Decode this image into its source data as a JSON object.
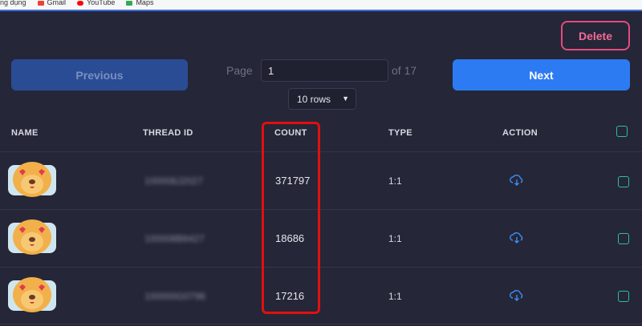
{
  "bookmarks": [
    {
      "label": "ng dụng",
      "color": "#4285f4"
    },
    {
      "label": "Gmail",
      "color": "#ea4335"
    },
    {
      "label": "YouTube",
      "color": "#ff0000"
    },
    {
      "label": "Maps",
      "color": "#34a853"
    }
  ],
  "toolbar": {
    "delete_label": "Delete",
    "previous_label": "Previous",
    "next_label": "Next",
    "page_label": "Page",
    "page_value": "1",
    "of_label": "of 17",
    "rows_value": "10 rows"
  },
  "table": {
    "headers": {
      "name": "NAME",
      "thread_id": "THREAD ID",
      "count": "COUNT",
      "type": "TYPE",
      "action": "ACTION"
    },
    "rows": [
      {
        "thread_id": "100008J2027",
        "count": "371797",
        "type": "1:1",
        "action_icon": "cloud-download-icon"
      },
      {
        "thread_id": "100008B8427",
        "count": "18686",
        "type": "1:1",
        "action_icon": "cloud-download-icon"
      },
      {
        "thread_id": "100000G0796",
        "count": "17216",
        "type": "1:1",
        "action_icon": "cloud-download-icon"
      }
    ]
  },
  "colors": {
    "background": "#252637",
    "accent": "#2d7bf3",
    "danger": "#e44b80",
    "checkbox": "#2fbf9a",
    "highlight": "#e01010"
  }
}
